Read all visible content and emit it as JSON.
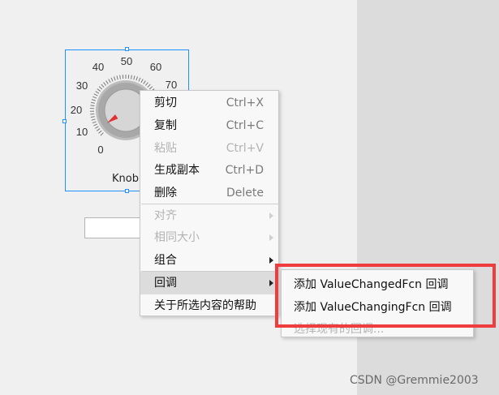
{
  "knob": {
    "ticks": [
      "0",
      "10",
      "20",
      "30",
      "40",
      "50",
      "60",
      "70"
    ],
    "label": "Knob",
    "value_fraction": 0.04,
    "colors": {
      "selection": "#1e90ff",
      "pointer": "#e03030"
    }
  },
  "context_menu": {
    "items": [
      {
        "label": "剪切",
        "shortcut": "Ctrl+X",
        "disabled": false
      },
      {
        "label": "复制",
        "shortcut": "Ctrl+C",
        "disabled": false
      },
      {
        "label": "粘贴",
        "shortcut": "Ctrl+V",
        "disabled": true
      },
      {
        "label": "生成副本",
        "shortcut": "Ctrl+D",
        "disabled": false
      },
      {
        "label": "删除",
        "shortcut": "Delete",
        "disabled": false
      },
      {
        "label": "对齐",
        "submenu": true,
        "disabled": true
      },
      {
        "label": "相同大小",
        "submenu": true,
        "disabled": true
      },
      {
        "label": "组合",
        "submenu": true,
        "disabled": false
      },
      {
        "label": "回调",
        "submenu": true,
        "disabled": false,
        "hover": true
      },
      {
        "label": "关于所选内容的帮助",
        "disabled": false
      }
    ]
  },
  "submenu": {
    "items": [
      {
        "label": "添加 ValueChangedFcn 回调"
      },
      {
        "label": "添加 ValueChangingFcn 回调"
      },
      {
        "label": "选择现有的回调..."
      }
    ]
  },
  "colors": {
    "highlight": "#ef3c3c"
  },
  "watermark": "CSDN @Gremmie2003"
}
